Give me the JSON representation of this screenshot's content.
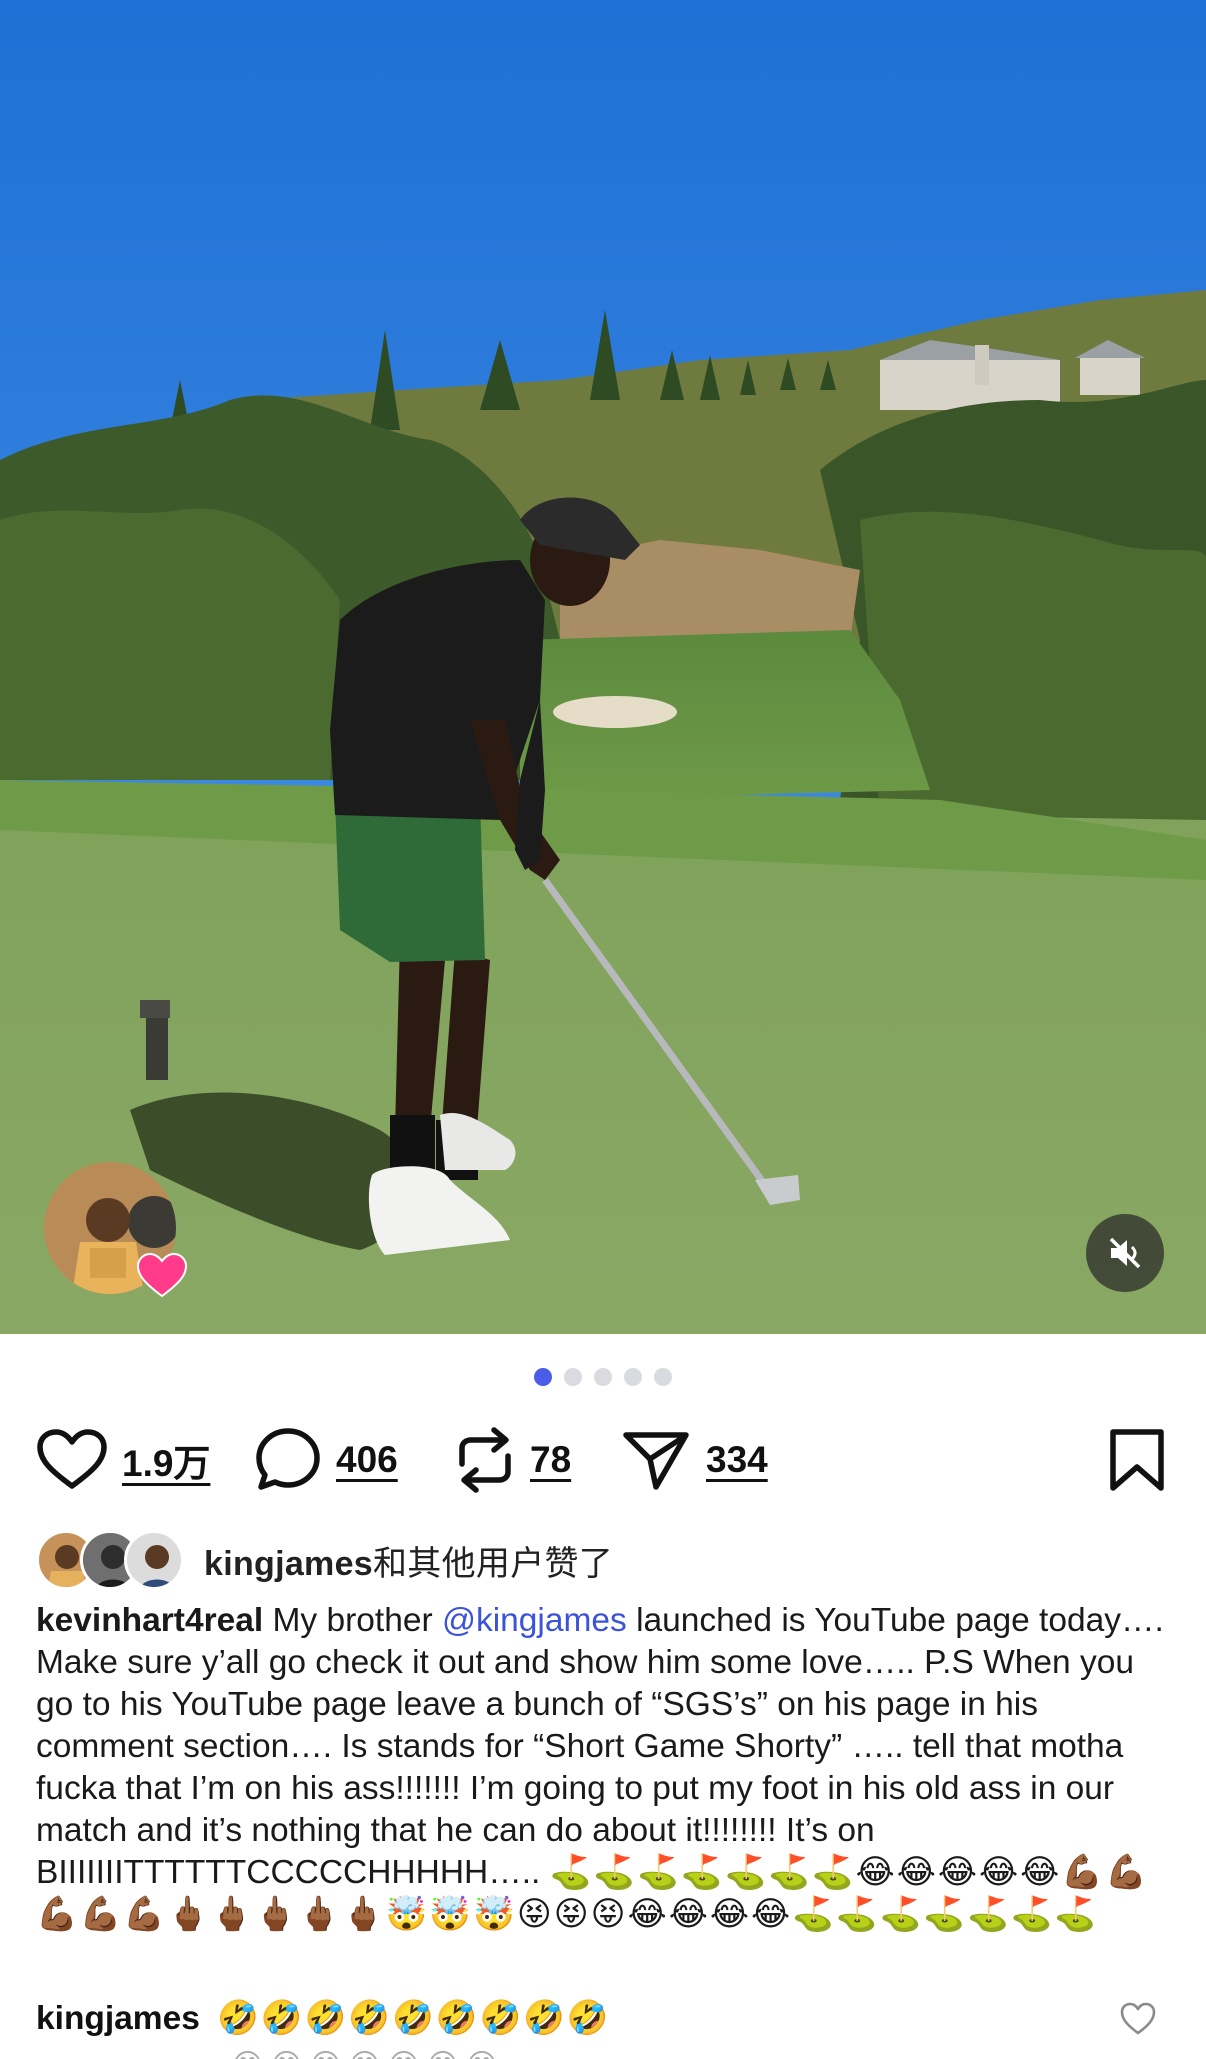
{
  "post": {
    "pager": {
      "count": 5,
      "active_index": 0
    },
    "actions": {
      "likes": "1.9万",
      "comments": "406",
      "reposts": "78",
      "shares": "334"
    },
    "liked_by": {
      "user": "kingjames",
      "suffix": "和其他用户赞了"
    },
    "caption": {
      "user": "kevinhart4real",
      "text_before": " My brother ",
      "mention": "@kingjames",
      "text_after": " launched is YouTube page today…. Make sure y’all go check it out and show him some love….. P.S When you go to his YouTube page leave a bunch of “SGS’s” on his page in his comment section…. Is stands for “Short Game Shorty” ….. tell that motha fucka that I’m on his ass!!!!!!! I’m going to put my foot in his old ass in our match and it’s nothing that he can do about it!!!!!!!! It’s on BIIIIIIITTTTTTCCCCCHHHHH….. ",
      "emojis": "⛳️⛳️⛳️⛳️⛳️⛳️⛳️😂😂😂😂😂💪🏾💪🏾💪🏾💪🏾💪🏾🖕🏾🖕🏾🖕🏾🖕🏾🖕🏾🤯🤯🤯😝😝😝😂😂😂😂⛳️⛳️⛳️⛳️⛳️⛳️⛳️"
    },
    "comment": {
      "user": "kingjames",
      "text": "🤣🤣🤣🤣🤣🤣🤣🤣🤣",
      "next_preview": "😂😂😂😂😂😂😂"
    },
    "colors": {
      "accent": "#4a5ce8",
      "mention": "#3b53d9",
      "heart_badge": "#ff3b8a"
    },
    "icons": [
      "heart-icon",
      "comment-icon",
      "repost-icon",
      "share-icon",
      "bookmark-icon",
      "mute-icon"
    ]
  }
}
